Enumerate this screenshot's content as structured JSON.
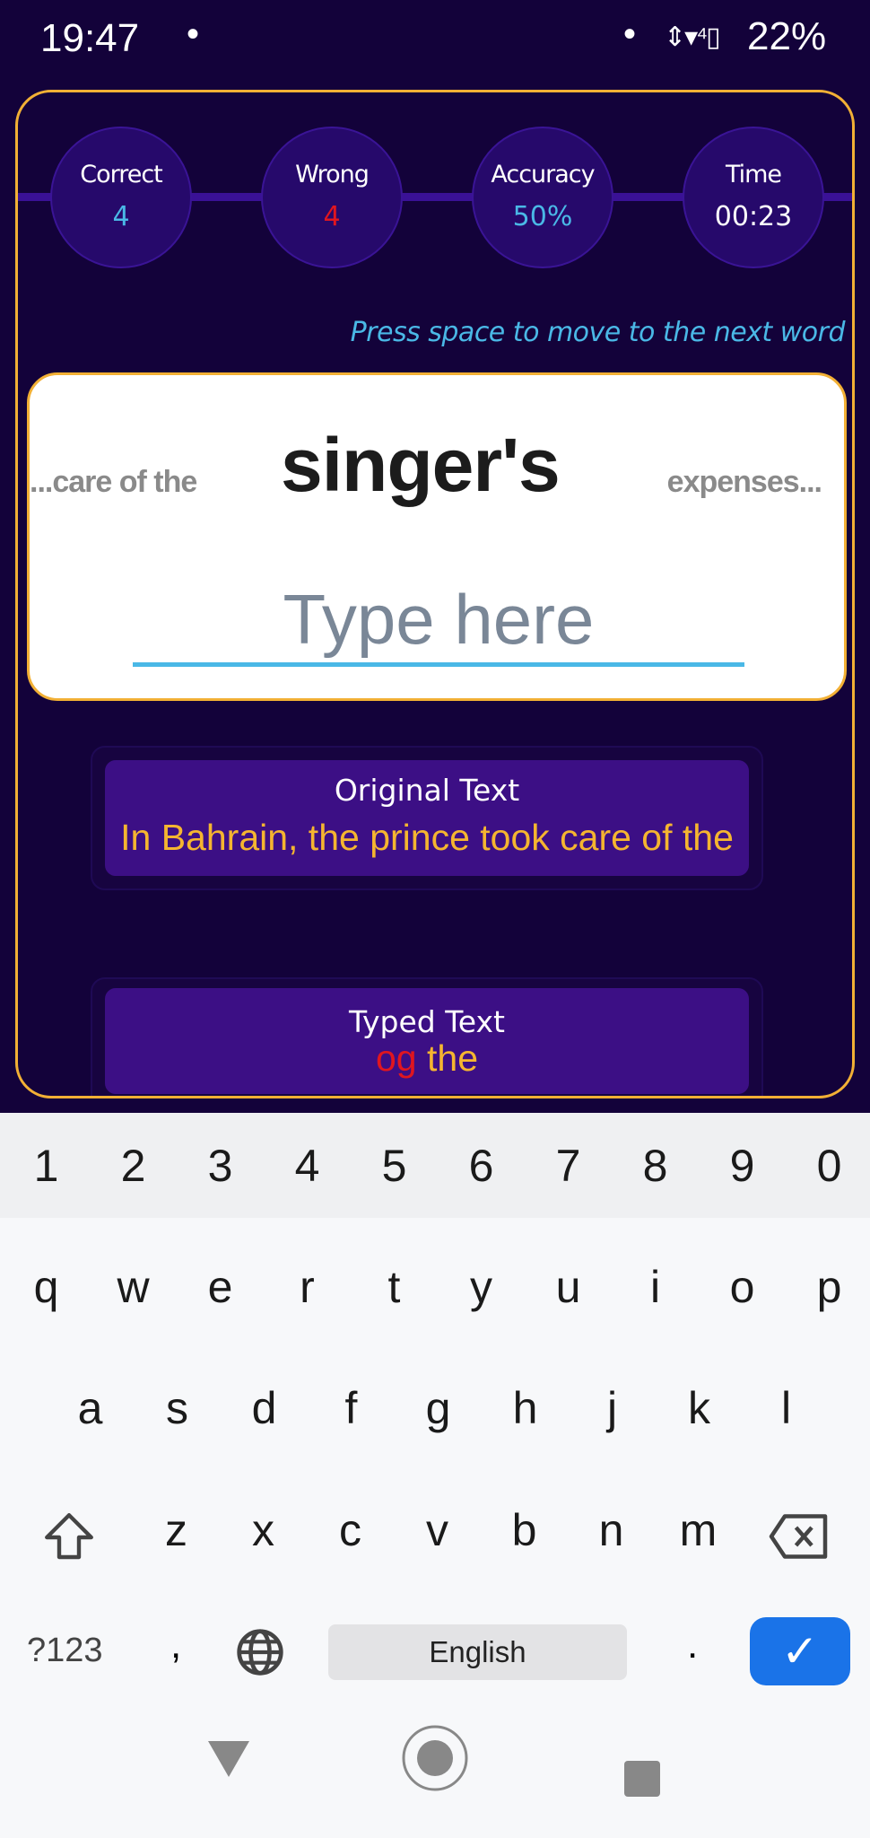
{
  "status_bar": {
    "time": "19:47",
    "dot": "•",
    "icons": "⇕▾⁴▯",
    "battery": "22%"
  },
  "stats": [
    {
      "label": "Correct",
      "value": "4",
      "color": "#4ab8e6"
    },
    {
      "label": "Wrong",
      "value": "4",
      "color": "#e0161f"
    },
    {
      "label": "Accuracy",
      "value": "50%",
      "color": "#4ab8e6"
    },
    {
      "label": "Time",
      "value": "00:23",
      "color": "#ffffff"
    }
  ],
  "hint": "Press space to move to the next word",
  "word_display": {
    "previous": "...care of the",
    "current": "singer's",
    "next": "expenses..."
  },
  "input": {
    "placeholder": "Type here",
    "value": ""
  },
  "original_panel": {
    "title": "Original Text",
    "text": "In Bahrain, the prince took care of the"
  },
  "typed_panel": {
    "title": "Typed Text",
    "wrong": "og",
    "correct": " the"
  },
  "colors": {
    "accent": "#f2b035",
    "background": "#13023a",
    "panel": "#3c0f85",
    "correct": "#f5b530",
    "wrong": "#e0161f",
    "enter": "#1a73e8"
  },
  "keyboard": {
    "numbers": [
      "1",
      "2",
      "3",
      "4",
      "5",
      "6",
      "7",
      "8",
      "9",
      "0"
    ],
    "row1": [
      "q",
      "w",
      "e",
      "r",
      "t",
      "y",
      "u",
      "i",
      "o",
      "p"
    ],
    "row2": [
      "a",
      "s",
      "d",
      "f",
      "g",
      "h",
      "j",
      "k",
      "l"
    ],
    "row3": [
      "z",
      "x",
      "c",
      "v",
      "b",
      "n",
      "m"
    ],
    "symbols": "?123",
    "comma": ",",
    "space": "English",
    "period": ".",
    "enter": "✓"
  }
}
